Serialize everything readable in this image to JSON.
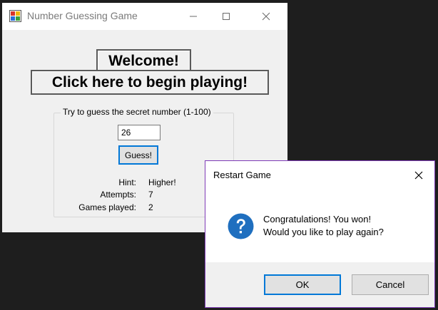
{
  "main_window": {
    "title": "Number Guessing Game",
    "welcome_label": "Welcome!",
    "begin_label": "Click here to begin playing!",
    "group_title": "Try to guess the secret number (1-100)",
    "guess_value": "26",
    "guess_button": "Guess!",
    "stats": {
      "hint_label": "Hint:",
      "hint_value": "Higher!",
      "attempts_label": "Attempts:",
      "attempts_value": "7",
      "games_label": "Games played:",
      "games_value": "2"
    }
  },
  "dialog": {
    "title": "Restart Game",
    "message_line1": "Congratulations! You won!",
    "message_line2": "Would you like to play again?",
    "ok_label": "OK",
    "cancel_label": "Cancel",
    "icon": "question-icon",
    "accent_color": "#0078d7"
  }
}
